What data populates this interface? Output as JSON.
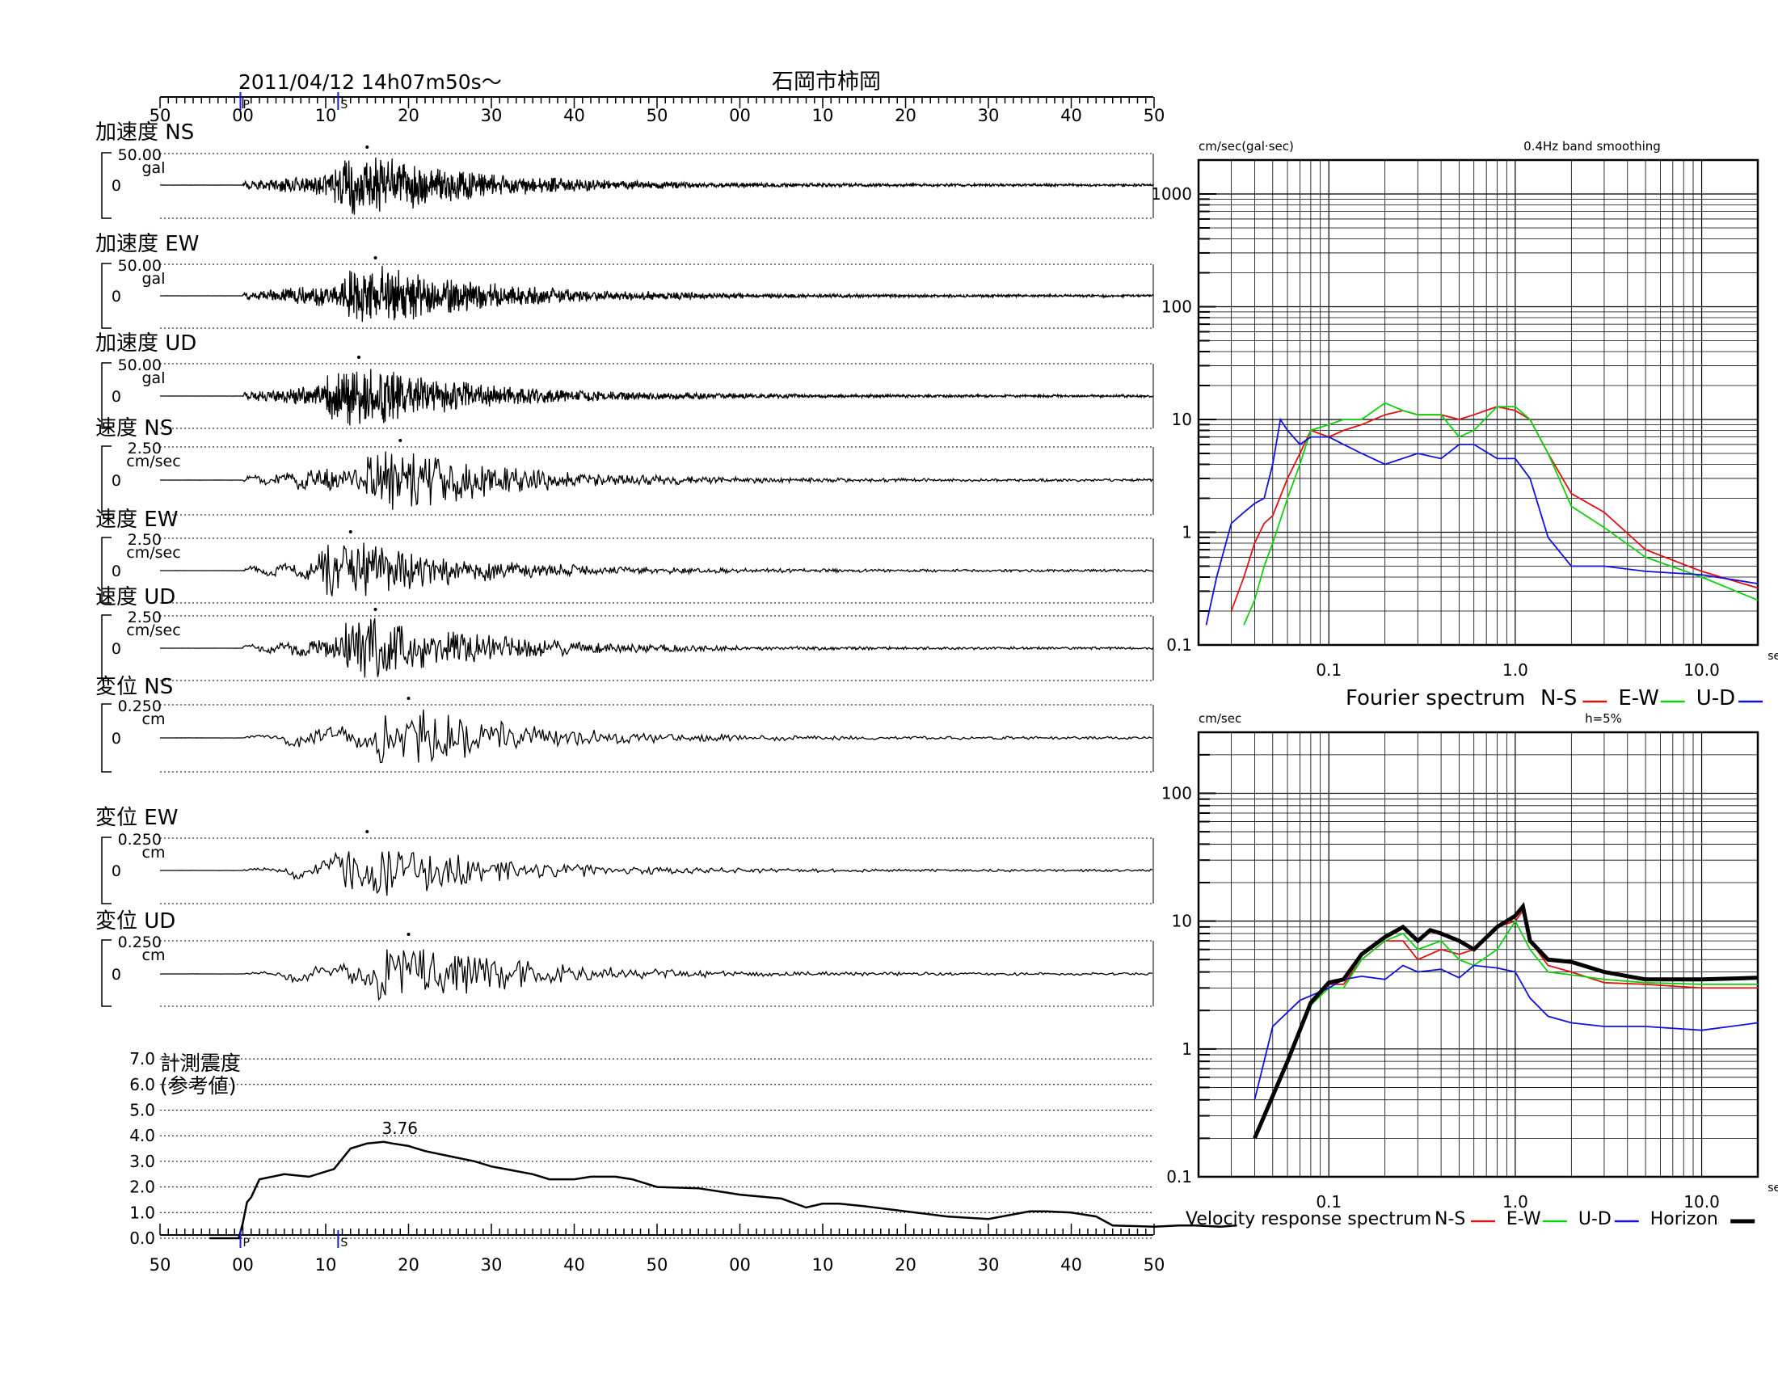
{
  "header": {
    "datetime": "2011/04/12  14h07m50s～",
    "station": "石岡市柿岡"
  },
  "time_axis": {
    "ticks": [
      "50",
      "00",
      "10",
      "20",
      "30",
      "40",
      "50",
      "00",
      "10",
      "20",
      "30",
      "40",
      "50"
    ],
    "markers": [
      {
        "label": "P",
        "color": "#1a1ad8"
      },
      {
        "label": "S",
        "color": "#1a1ad8"
      }
    ]
  },
  "traces": [
    {
      "title": "加速度 NS",
      "max": "50.00",
      "unit": "gal",
      "zero": "0"
    },
    {
      "title": "加速度 EW",
      "max": "50.00",
      "unit": "gal",
      "zero": "0"
    },
    {
      "title": "加速度 UD",
      "max": "50.00",
      "unit": "gal",
      "zero": "0"
    },
    {
      "title": "速度 NS",
      "max": "2.50",
      "unit": "cm/sec",
      "zero": "0"
    },
    {
      "title": "速度 EW",
      "max": "2.50",
      "unit": "cm/sec",
      "zero": "0"
    },
    {
      "title": "速度 UD",
      "max": "2.50",
      "unit": "cm/sec",
      "zero": "0"
    },
    {
      "title": "変位 NS",
      "max": "0.250",
      "unit": "cm",
      "zero": "0"
    },
    {
      "title": "変位 EW",
      "max": "0.250",
      "unit": "cm",
      "zero": "0"
    },
    {
      "title": "変位 UD",
      "max": "0.250",
      "unit": "cm",
      "zero": "0"
    }
  ],
  "intensity": {
    "title1": "計測震度",
    "title2": "(参考値)",
    "peak_label": "3.76",
    "yticks": [
      "7.0",
      "6.0",
      "5.0",
      "4.0",
      "3.0",
      "2.0",
      "1.0",
      "0.0"
    ]
  },
  "colors": {
    "ns": "#e01010",
    "ew": "#10d010",
    "ud": "#1010e0",
    "horizon": "#000000",
    "marker": "#1a1ad8"
  },
  "chart_data": [
    {
      "type": "line",
      "title": "計測震度 (参考値)",
      "x_unit": "sec",
      "ylim": [
        0,
        7
      ],
      "x": [
        -4,
        -0.5,
        0,
        0.5,
        1,
        2,
        5,
        8,
        10,
        11,
        12,
        13,
        15,
        17,
        18,
        20,
        22,
        25,
        28,
        30,
        35,
        37,
        40,
        42,
        45,
        47,
        50,
        55,
        58,
        60,
        65,
        68,
        70,
        72,
        75,
        80,
        85,
        90,
        95,
        97,
        100,
        103,
        105,
        110,
        113,
        115,
        118,
        120
      ],
      "values": [
        0,
        0,
        0.6,
        1.4,
        1.6,
        2.3,
        2.5,
        2.4,
        2.6,
        2.7,
        3.1,
        3.5,
        3.7,
        3.76,
        3.7,
        3.6,
        3.4,
        3.2,
        3.0,
        2.8,
        2.5,
        2.3,
        2.3,
        2.4,
        2.4,
        2.3,
        2.0,
        1.95,
        1.8,
        1.7,
        1.55,
        1.2,
        1.35,
        1.35,
        1.25,
        1.05,
        0.85,
        0.75,
        1.05,
        1.05,
        1.0,
        0.85,
        0.5,
        0.45,
        0.5,
        0.5,
        0.45,
        0.5
      ]
    },
    {
      "type": "line",
      "title": "Fourier spectrum",
      "annotation": "0.4Hz band smoothing",
      "ylabel": "cm/sec(gal·sec)",
      "xlabel": "sec",
      "xscale": "log",
      "yscale": "log",
      "xlim": [
        0.02,
        20
      ],
      "ylim": [
        0.1,
        2000
      ],
      "xticks": [
        "0.1",
        "1.0",
        "10.0"
      ],
      "yticks": [
        "1000",
        "100",
        "10",
        "1",
        "0.1"
      ],
      "legend_title": "Fourier spectrum",
      "series": [
        {
          "name": "N-S",
          "color": "#e01010",
          "x": [
            0.03,
            0.035,
            0.04,
            0.045,
            0.05,
            0.06,
            0.07,
            0.08,
            0.1,
            0.12,
            0.15,
            0.2,
            0.25,
            0.3,
            0.4,
            0.5,
            0.6,
            0.8,
            1.0,
            1.2,
            1.5,
            2,
            3,
            5,
            10,
            20
          ],
          "y": [
            0.2,
            0.4,
            0.8,
            1.2,
            1.4,
            3,
            5,
            8,
            7,
            8,
            9,
            11,
            12,
            11,
            11,
            10,
            11,
            13,
            12,
            10,
            5,
            2.2,
            1.5,
            0.7,
            0.45,
            0.32
          ]
        },
        {
          "name": "E-W",
          "color": "#10d010",
          "x": [
            0.035,
            0.04,
            0.045,
            0.05,
            0.06,
            0.07,
            0.08,
            0.1,
            0.12,
            0.15,
            0.2,
            0.25,
            0.3,
            0.4,
            0.5,
            0.6,
            0.8,
            1.0,
            1.2,
            1.5,
            2,
            3,
            5,
            10,
            20
          ],
          "y": [
            0.15,
            0.25,
            0.5,
            0.8,
            2,
            4,
            8,
            9,
            10,
            10,
            14,
            12,
            11,
            11,
            7,
            8,
            13,
            13,
            10,
            5,
            1.7,
            1.1,
            0.6,
            0.4,
            0.25
          ]
        },
        {
          "name": "U-D",
          "color": "#1010e0",
          "x": [
            0.022,
            0.025,
            0.03,
            0.035,
            0.04,
            0.045,
            0.05,
            0.055,
            0.06,
            0.07,
            0.08,
            0.1,
            0.12,
            0.15,
            0.2,
            0.3,
            0.4,
            0.5,
            0.6,
            0.8,
            1.0,
            1.2,
            1.5,
            2,
            3,
            5,
            10,
            20
          ],
          "y": [
            0.15,
            0.4,
            1.2,
            1.5,
            1.8,
            2,
            4,
            10,
            8,
            6,
            7,
            7,
            6,
            5,
            4,
            5,
            4.5,
            6,
            6,
            4.5,
            4.5,
            3,
            0.9,
            0.5,
            0.5,
            0.45,
            0.42,
            0.35
          ]
        }
      ]
    },
    {
      "type": "line",
      "title": "Velocity response spectrum",
      "annotation": "h=5%",
      "ylabel": "cm/sec",
      "xlabel": "sec",
      "xscale": "log",
      "yscale": "log",
      "xlim": [
        0.02,
        20
      ],
      "ylim": [
        0.1,
        300
      ],
      "xticks": [
        "0.1",
        "1.0",
        "10.0"
      ],
      "yticks": [
        "100",
        "10",
        "1",
        "0.1"
      ],
      "legend_title": "Velocity response spectrum",
      "series": [
        {
          "name": "N-S",
          "color": "#e01010",
          "x": [
            0.04,
            0.06,
            0.08,
            0.1,
            0.12,
            0.15,
            0.2,
            0.25,
            0.3,
            0.4,
            0.5,
            0.6,
            0.8,
            1.0,
            1.1,
            1.2,
            1.5,
            2,
            3,
            5,
            10,
            20
          ],
          "y": [
            0.2,
            0.8,
            2.2,
            3.2,
            3.2,
            5,
            7,
            7,
            5,
            6,
            5.5,
            6,
            9,
            10,
            12,
            7,
            4.5,
            4,
            3.3,
            3.2,
            3.0,
            3.0
          ]
        },
        {
          "name": "E-W",
          "color": "#10d010",
          "x": [
            0.04,
            0.06,
            0.08,
            0.1,
            0.12,
            0.15,
            0.2,
            0.25,
            0.3,
            0.4,
            0.5,
            0.6,
            0.8,
            1.0,
            1.2,
            1.5,
            2,
            3,
            5,
            10,
            20
          ],
          "y": [
            0.2,
            0.8,
            2.2,
            3.0,
            3.0,
            5,
            7,
            8,
            6,
            7,
            5,
            4.5,
            6,
            10,
            6,
            4,
            3.8,
            3.5,
            3.3,
            3.2,
            3.2
          ]
        },
        {
          "name": "U-D",
          "color": "#1010e0",
          "x": [
            0.04,
            0.05,
            0.07,
            0.1,
            0.12,
            0.15,
            0.2,
            0.25,
            0.3,
            0.4,
            0.5,
            0.6,
            0.8,
            1.0,
            1.2,
            1.5,
            2,
            3,
            5,
            10,
            20
          ],
          "y": [
            0.4,
            1.5,
            2.4,
            3.0,
            3.5,
            3.7,
            3.5,
            4.5,
            4.0,
            4.2,
            3.6,
            4.5,
            4.3,
            4.0,
            2.5,
            1.8,
            1.6,
            1.5,
            1.5,
            1.4,
            1.6
          ]
        },
        {
          "name": "Horizon",
          "color": "#000000",
          "x": [
            0.04,
            0.06,
            0.08,
            0.1,
            0.12,
            0.15,
            0.2,
            0.25,
            0.3,
            0.35,
            0.4,
            0.5,
            0.6,
            0.8,
            1.0,
            1.1,
            1.2,
            1.5,
            2,
            3,
            5,
            10,
            20
          ],
          "y": [
            0.2,
            0.8,
            2.3,
            3.3,
            3.5,
            5.5,
            7.5,
            9,
            7,
            8.5,
            8,
            7,
            6,
            9,
            11,
            13,
            7,
            5,
            4.8,
            4,
            3.5,
            3.5,
            3.6
          ]
        }
      ]
    }
  ]
}
